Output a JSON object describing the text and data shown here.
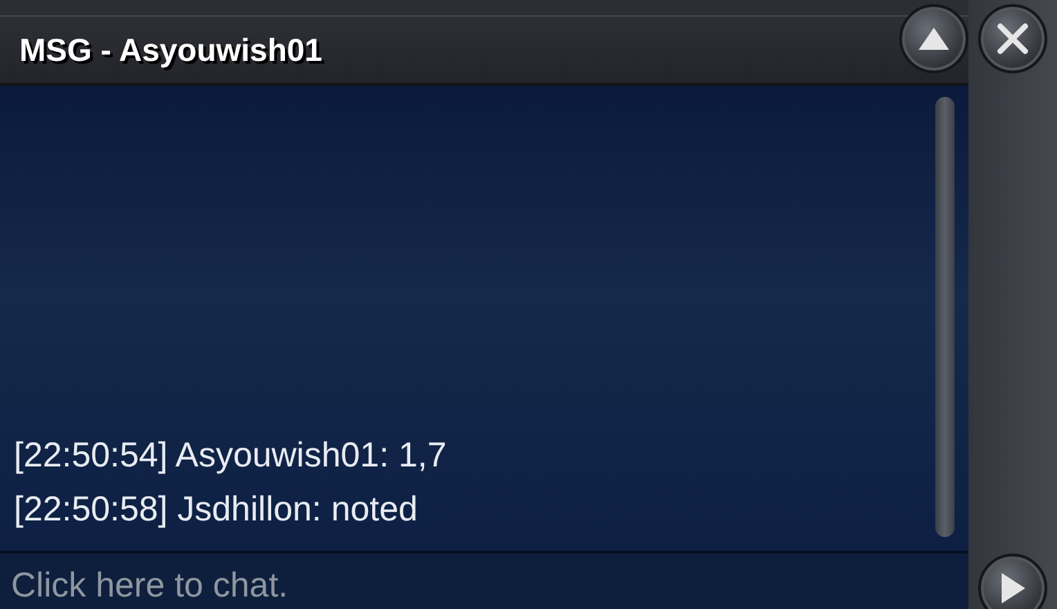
{
  "window": {
    "title": "MSG - Asyouwish01"
  },
  "messages": [
    {
      "text": "[22:50:54] Asyouwish01: 1,7"
    },
    {
      "text": "[22:50:58] Jsdhillon: noted"
    }
  ],
  "input": {
    "placeholder": "Click here to chat."
  }
}
